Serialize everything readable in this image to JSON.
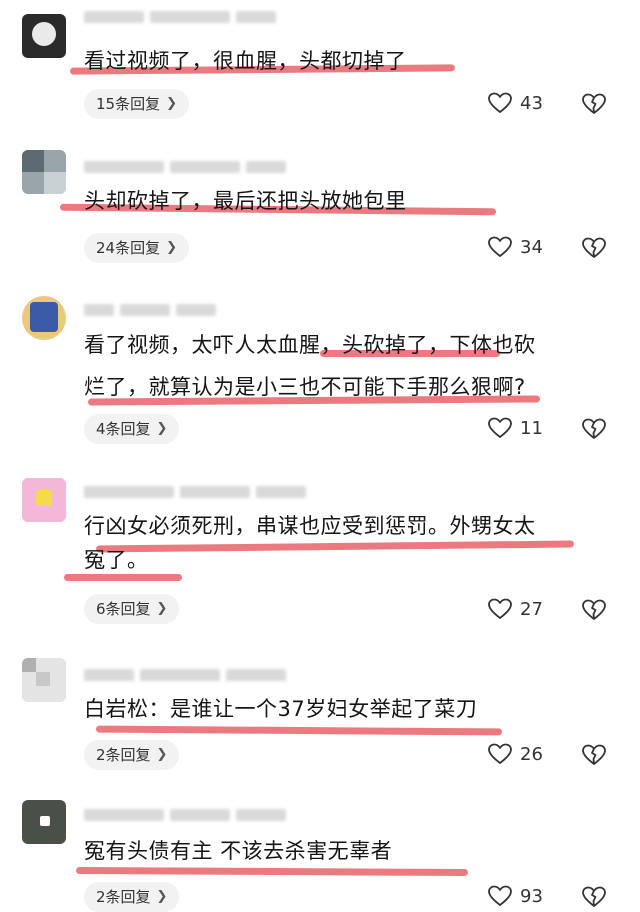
{
  "comments": [
    {
      "text_lines": [
        "看过视频了，很血腥，头都切掉了"
      ],
      "replies_label": "15条回复",
      "likes": "43",
      "avatar_color": "#2b2b2b"
    },
    {
      "text_lines": [
        "头却砍掉了，最后还把头放她包里"
      ],
      "replies_label": "24条回复",
      "likes": "34",
      "avatar_color": "#5c6b72"
    },
    {
      "text_lines": [
        "看了视频，太吓人太血腥，头砍掉了，下体也砍",
        "烂了，就算认为是小三也不可能下手那么狠啊?"
      ],
      "replies_label": "4条回复",
      "likes": "11",
      "avatar_color": "#3b5ba8"
    },
    {
      "text_lines": [
        "行凶女必须死刑，串谋也应受到惩罚。外甥女太",
        "冤了。"
      ],
      "replies_label": "6条回复",
      "likes": "27",
      "avatar_color": "#f3b8d7"
    },
    {
      "text_lines": [
        "白岩松：是谁让一个37岁妇女举起了菜刀"
      ],
      "replies_label": "2条回复",
      "likes": "26",
      "avatar_color": "#d8d8d8"
    },
    {
      "text_lines": [
        "冤有头债有主 不该去杀害无辜者"
      ],
      "replies_label": "2条回复",
      "likes": "93",
      "avatar_color": "#4a5048"
    }
  ],
  "colors": {
    "highlight": "#e8636a",
    "reply_bg": "#f2f2f2"
  },
  "icons": {
    "like": "heart-outline-icon",
    "dislike": "broken-heart-icon",
    "chevron": "chevron-right-icon"
  }
}
